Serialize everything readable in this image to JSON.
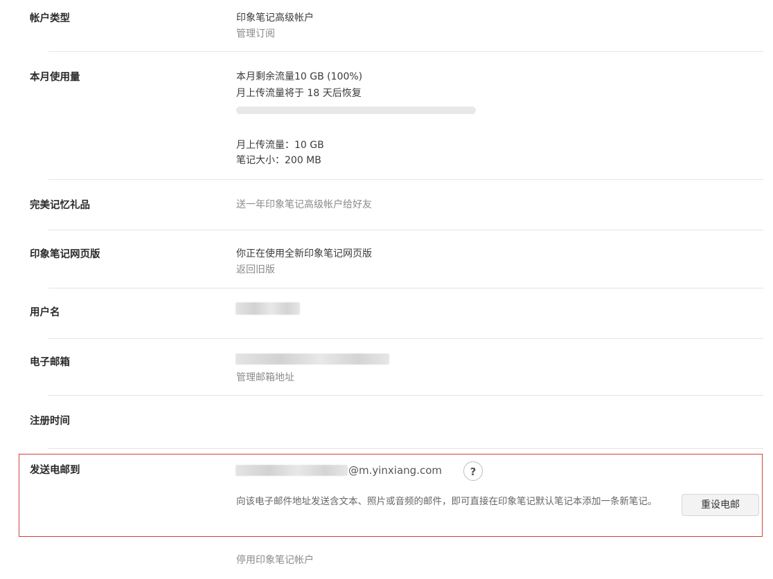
{
  "rows": {
    "account_type": {
      "label": "帐户类型",
      "value": "印象笔记高级帐户",
      "link": "管理订阅"
    },
    "monthly_usage": {
      "label": "本月使用量",
      "remaining": "本月剩余流量10 GB (100%)",
      "reset": "月上传流量将于 18 天后恢复",
      "usage_fraction": 0,
      "upload_limit": "月上传流量：10 GB",
      "note_size": "笔记大小：200 MB"
    },
    "gift": {
      "label": "完美记忆礼品",
      "link": "送一年印象笔记高级帐户给好友"
    },
    "web_version": {
      "label": "印象笔记网页版",
      "value": "你正在使用全新印象笔记网页版",
      "link": "返回旧版"
    },
    "username": {
      "label": "用户名"
    },
    "email": {
      "label": "电子邮箱",
      "link": "管理邮箱地址"
    },
    "register_time": {
      "label": "注册时间"
    },
    "email_to": {
      "label": "发送电邮到",
      "address_suffix": "@m.yinxiang.com",
      "help_icon": "?",
      "description": "向该电子邮件地址发送含文本、照片或音频的邮件，即可直接在印象笔记默认笔记本添加一条新笔记。",
      "reset_button": "重设电邮"
    }
  },
  "footer": {
    "deactivate": "停用印象笔记帐户"
  },
  "colors": {
    "highlight": "#d43c3c",
    "divider": "#e4e4e4"
  }
}
